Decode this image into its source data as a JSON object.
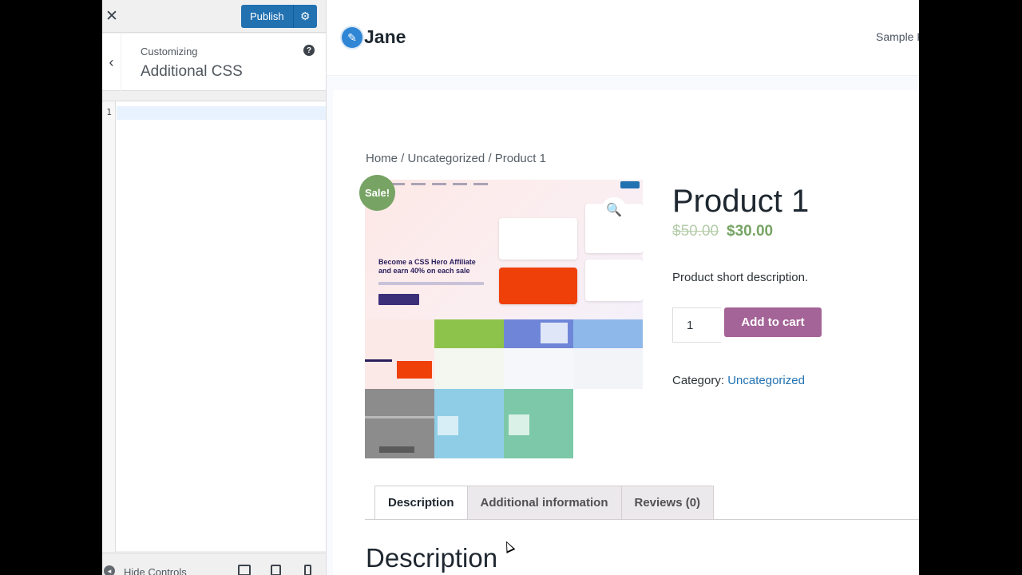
{
  "customizer": {
    "close_icon": "close-icon",
    "publish_label": "Publish",
    "settings_icon": "gear-icon",
    "back_icon": "chevron-left-icon",
    "customizing_label": "Customizing",
    "section_title": "Additional CSS",
    "help_icon": "help-icon",
    "editor": {
      "line_numbers": [
        "1"
      ],
      "code": ""
    },
    "footer": {
      "hide_controls_label": "Hide Controls",
      "devices": [
        "desktop-icon",
        "tablet-icon",
        "mobile-icon"
      ]
    },
    "colors": {
      "primary": "#2271b1",
      "background": "#f0f0f1"
    }
  },
  "site": {
    "title": "Jane",
    "logo_icon": "pen-icon",
    "nav_item": "Sample P",
    "breadcrumb": "Home / Uncategorized / Product 1",
    "product": {
      "sale_badge": "Sale!",
      "zoom_icon": "magnifier-icon",
      "gallery_headline": "Become a CSS Hero Affiliate and earn 40% on each sale",
      "title": "Product 1",
      "price_old": "$50.00",
      "price_new": "$30.00",
      "short_description": "Product short description.",
      "quantity": "1",
      "add_to_cart_label": "Add to cart",
      "category_label": "Category:",
      "category_value": "Uncategorized"
    },
    "tabs": [
      {
        "label": "Description",
        "active": true
      },
      {
        "label": "Additional information",
        "active": false
      },
      {
        "label": "Reviews (0)",
        "active": false
      }
    ],
    "description_heading": "Description",
    "colors": {
      "price": "#77a464",
      "button": "#a46497",
      "link": "#2271b1"
    }
  }
}
